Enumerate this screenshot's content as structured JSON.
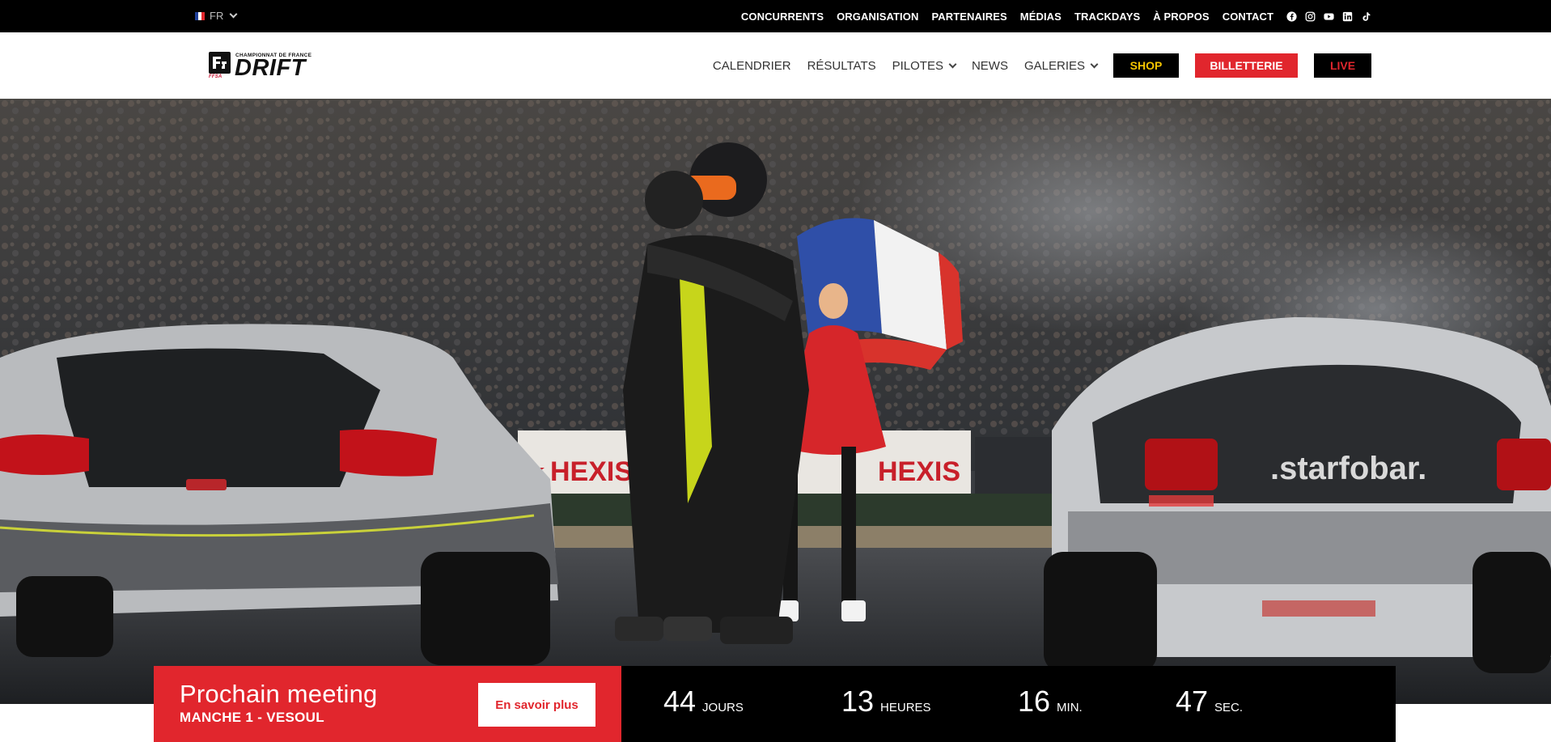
{
  "topbar": {
    "language": "FR",
    "links": [
      "CONCURRENTS",
      "ORGANISATION",
      "PARTENAIRES",
      "MÉDIAS",
      "TRACKDAYS",
      "À PROPOS",
      "CONTACT"
    ],
    "socials": [
      "facebook-icon",
      "instagram-icon",
      "youtube-icon",
      "linkedin-icon",
      "tiktok-icon"
    ]
  },
  "logo": {
    "championnat": "CHAMPIONNAT DE FRANCE",
    "name": "DRIFT",
    "federation": "FFSA"
  },
  "nav": {
    "calendrier": "CALENDRIER",
    "resultats": "RÉSULTATS",
    "pilotes": "PILOTES",
    "news": "NEWS",
    "galeries": "GALERIES",
    "shop": "SHOP",
    "billetterie": "BILLETTERIE",
    "live": "LIVE"
  },
  "colors": {
    "accent_red": "#e1262d",
    "shop_yellow": "#f4c400",
    "bar_black": "#000000"
  },
  "meeting": {
    "title": "Prochain meeting",
    "subtitle": "MANCHE 1 - VESOUL",
    "cta": "En savoir plus"
  },
  "countdown": [
    {
      "value": "44",
      "label": "JOURS"
    },
    {
      "value": "13",
      "label": "HEURES"
    },
    {
      "value": "16",
      "label": "MIN."
    },
    {
      "value": "47",
      "label": "SEC."
    }
  ],
  "hero": {
    "banner_left": "HEXIS",
    "banner_mid": "HEXIS",
    "car_right_brand": ".starfobar."
  }
}
